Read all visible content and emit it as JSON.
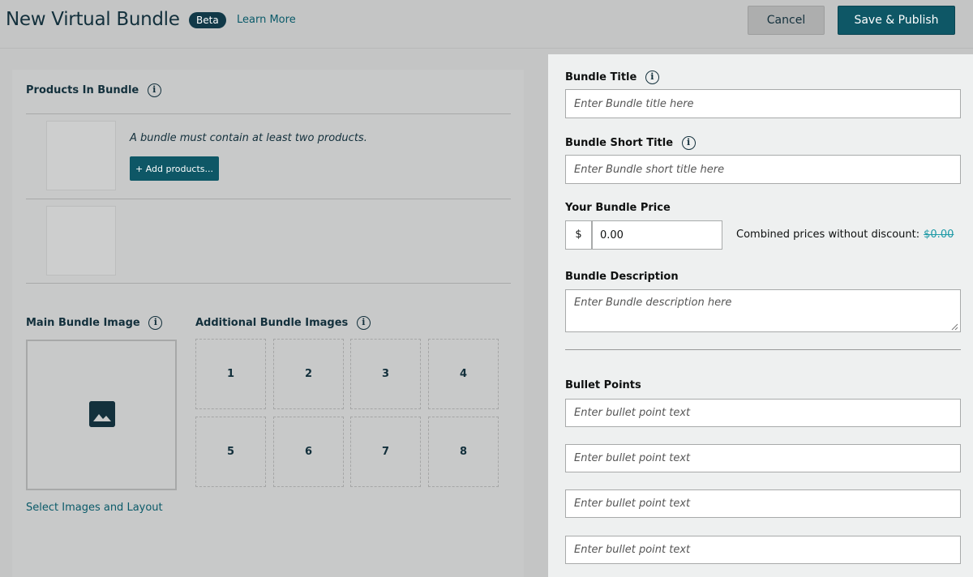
{
  "header": {
    "title": "New Virtual Bundle",
    "badge": "Beta",
    "learn_more": "Learn More",
    "cancel": "Cancel",
    "publish": "Save & Publish"
  },
  "left": {
    "products_title": "Products In Bundle",
    "note": "A bundle must contain at least two products.",
    "add_products": "+ Add products...",
    "main_image_title": "Main Bundle Image",
    "additional_images_title": "Additional Bundle Images",
    "slots": [
      "1",
      "2",
      "3",
      "4",
      "5",
      "6",
      "7",
      "8"
    ],
    "select_layout": "Select Images and Layout"
  },
  "right": {
    "bundle_title_label": "Bundle Title",
    "bundle_title_placeholder": "Enter Bundle title here",
    "short_title_label": "Bundle Short Title",
    "short_title_placeholder": "Enter Bundle short title here",
    "price_label": "Your Bundle Price",
    "currency": "$",
    "price_value": "0.00",
    "combined_label": "Combined prices without discount:",
    "combined_value": "$0.00",
    "description_label": "Bundle Description",
    "description_placeholder": "Enter Bundle description here",
    "bullets_label": "Bullet Points",
    "bullet_placeholders": [
      "Enter bullet point text",
      "Enter bullet point text",
      "Enter bullet point text",
      "Enter bullet point text"
    ]
  },
  "colors": {
    "accent": "#0e5766",
    "link": "#0a5a69",
    "strike_price": "#1e9aa6"
  }
}
